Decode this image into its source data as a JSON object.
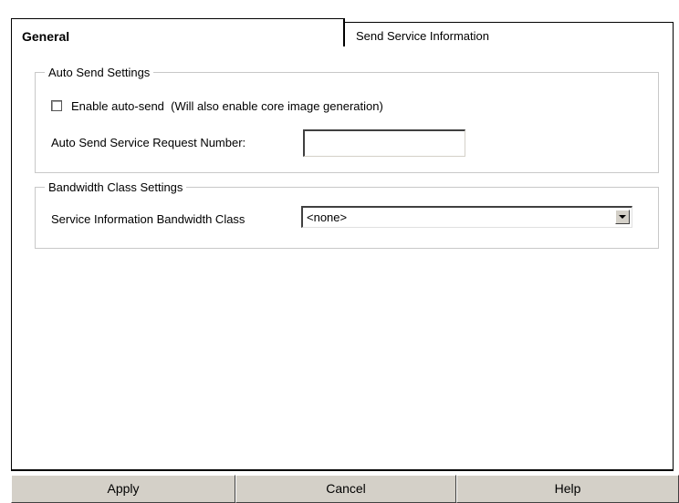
{
  "tabs": [
    {
      "label": "General",
      "active": true
    },
    {
      "label": "Send Service Information",
      "active": false
    }
  ],
  "auto_send": {
    "legend": "Auto Send Settings",
    "enable_label": "Enable auto-send  (Will also enable core image generation)",
    "enable_checked": false,
    "request_number_label": "Auto Send Service Request Number:",
    "request_number_value": ""
  },
  "bandwidth": {
    "legend": "Bandwidth Class Settings",
    "class_label": "Service Information Bandwidth Class",
    "class_value": "<none>",
    "dropdown_icon": "chevron-down-icon"
  },
  "buttons": {
    "apply": "Apply",
    "cancel": "Cancel",
    "help": "Help"
  },
  "colors": {
    "button_face": "#d4d0c8",
    "group_border": "#c8c8c8"
  }
}
